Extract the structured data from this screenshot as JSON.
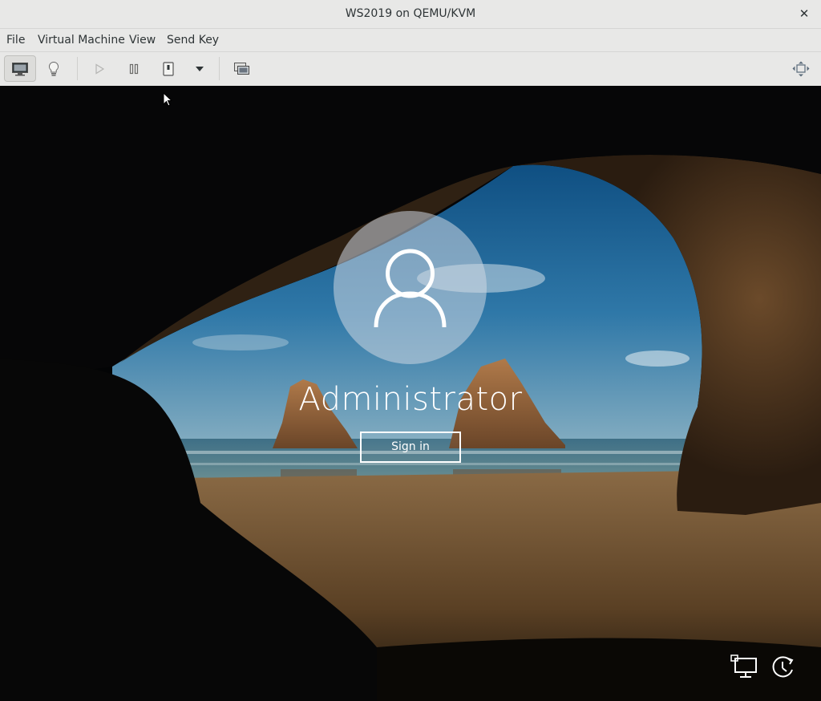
{
  "window": {
    "title": "WS2019 on QEMU/KVM",
    "close_glyph": "✕"
  },
  "menu": {
    "items": [
      "File",
      "Virtual Machine",
      "View",
      "Send Key"
    ]
  },
  "toolbar": {
    "buttons": [
      {
        "icon": "monitor-console-icon",
        "active": true
      },
      {
        "icon": "lightbulb-details-icon"
      },
      {
        "icon": "play-run-icon",
        "disabled": true
      },
      {
        "icon": "pause-icon"
      },
      {
        "icon": "power-shutdown-icon"
      },
      {
        "icon": "dropdown-arrow-icon"
      },
      {
        "icon": "snapshots-icon"
      },
      {
        "icon": "fullscreen-resize-icon"
      }
    ]
  },
  "login": {
    "username": "Administrator",
    "signin_label": "Sign in"
  },
  "tray": {
    "icons": [
      "network-icon",
      "ease-of-access-icon"
    ]
  }
}
